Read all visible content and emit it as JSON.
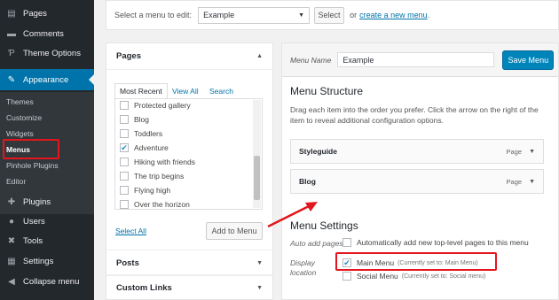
{
  "sidebar": {
    "items": [
      {
        "label": "Pages",
        "icon": "pages-icon"
      },
      {
        "label": "Comments",
        "icon": "comments-icon"
      },
      {
        "label": "Theme Options",
        "icon": "theme-options-icon"
      },
      {
        "label": "Appearance",
        "icon": "appearance-icon"
      },
      {
        "label": "Plugins",
        "icon": "plugins-icon"
      },
      {
        "label": "Users",
        "icon": "users-icon"
      },
      {
        "label": "Tools",
        "icon": "tools-icon"
      },
      {
        "label": "Settings",
        "icon": "settings-icon"
      },
      {
        "label": "Collapse menu",
        "icon": "collapse-icon"
      }
    ],
    "submenu": [
      "Themes",
      "Customize",
      "Widgets",
      "Menus",
      "Pinhole Plugins",
      "Editor"
    ],
    "accent": "#0073aa"
  },
  "topbar": {
    "label": "Select a menu to edit:",
    "selected_menu": "Example",
    "select_button": "Select",
    "or_text": "or",
    "create_link": "create a new menu",
    "after_link": "."
  },
  "pages_box": {
    "title": "Pages",
    "tabs": [
      "Most Recent",
      "View All",
      "Search"
    ],
    "items": [
      {
        "label": "Protected gallery",
        "checked": false
      },
      {
        "label": "Blog",
        "checked": false
      },
      {
        "label": "Toddlers",
        "checked": false
      },
      {
        "label": "Adventure",
        "checked": true
      },
      {
        "label": "Hiking with friends",
        "checked": false
      },
      {
        "label": "The trip begins",
        "checked": false
      },
      {
        "label": "Flying high",
        "checked": false
      },
      {
        "label": "Over the horizon",
        "checked": false
      }
    ],
    "select_all": "Select All",
    "add_button": "Add to Menu"
  },
  "posts_box": {
    "title": "Posts"
  },
  "custom_links_box": {
    "title": "Custom Links"
  },
  "menu_editor": {
    "name_label": "Menu Name",
    "name_value": "Example",
    "save_button": "Save Menu",
    "structure_title": "Menu Structure",
    "structure_desc_1": "Drag each item into the order you prefer. Click the arrow on the right of the",
    "structure_desc_2": "item to reveal additional configuration options.",
    "items": [
      {
        "title": "Styleguide",
        "type": "Page"
      },
      {
        "title": "Blog",
        "type": "Page"
      }
    ],
    "settings_title": "Menu Settings",
    "auto_add_label": "Auto add pages",
    "auto_add_text": "Automatically add new top-level pages to this menu",
    "display_location_label_1": "Display",
    "display_location_label_2": "location",
    "locations": [
      {
        "label": "Main Menu",
        "note": "(Currently set to: Main Menu)",
        "checked": true
      },
      {
        "label": "Social Menu",
        "note": "(Currently set to: Social menu)",
        "checked": false
      }
    ]
  },
  "highlight_color": "#e3161d"
}
